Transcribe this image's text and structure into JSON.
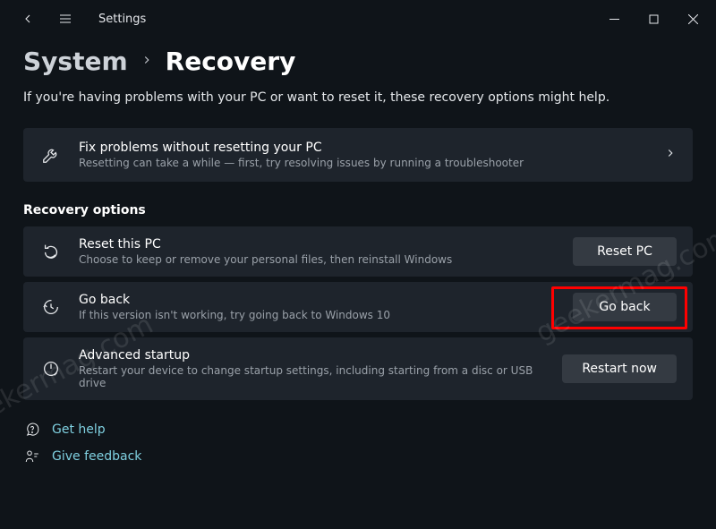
{
  "window": {
    "app_title": "Settings"
  },
  "breadcrumb": {
    "parent": "System",
    "current": "Recovery"
  },
  "subtitle": "If you're having problems with your PC or want to reset it, these recovery options might help.",
  "fix_card": {
    "title": "Fix problems without resetting your PC",
    "desc": "Resetting can take a while — first, try resolving issues by running a troubleshooter"
  },
  "section_header": "Recovery options",
  "options": {
    "reset": {
      "title": "Reset this PC",
      "desc": "Choose to keep or remove your personal files, then reinstall Windows",
      "button": "Reset PC"
    },
    "goback": {
      "title": "Go back",
      "desc": "If this version isn't working, try going back to Windows 10",
      "button": "Go back"
    },
    "advanced": {
      "title": "Advanced startup",
      "desc": "Restart your device to change startup settings, including starting from a disc or USB drive",
      "button": "Restart now"
    }
  },
  "links": {
    "help": "Get help",
    "feedback": "Give feedback"
  },
  "watermark": "geekermag.com"
}
